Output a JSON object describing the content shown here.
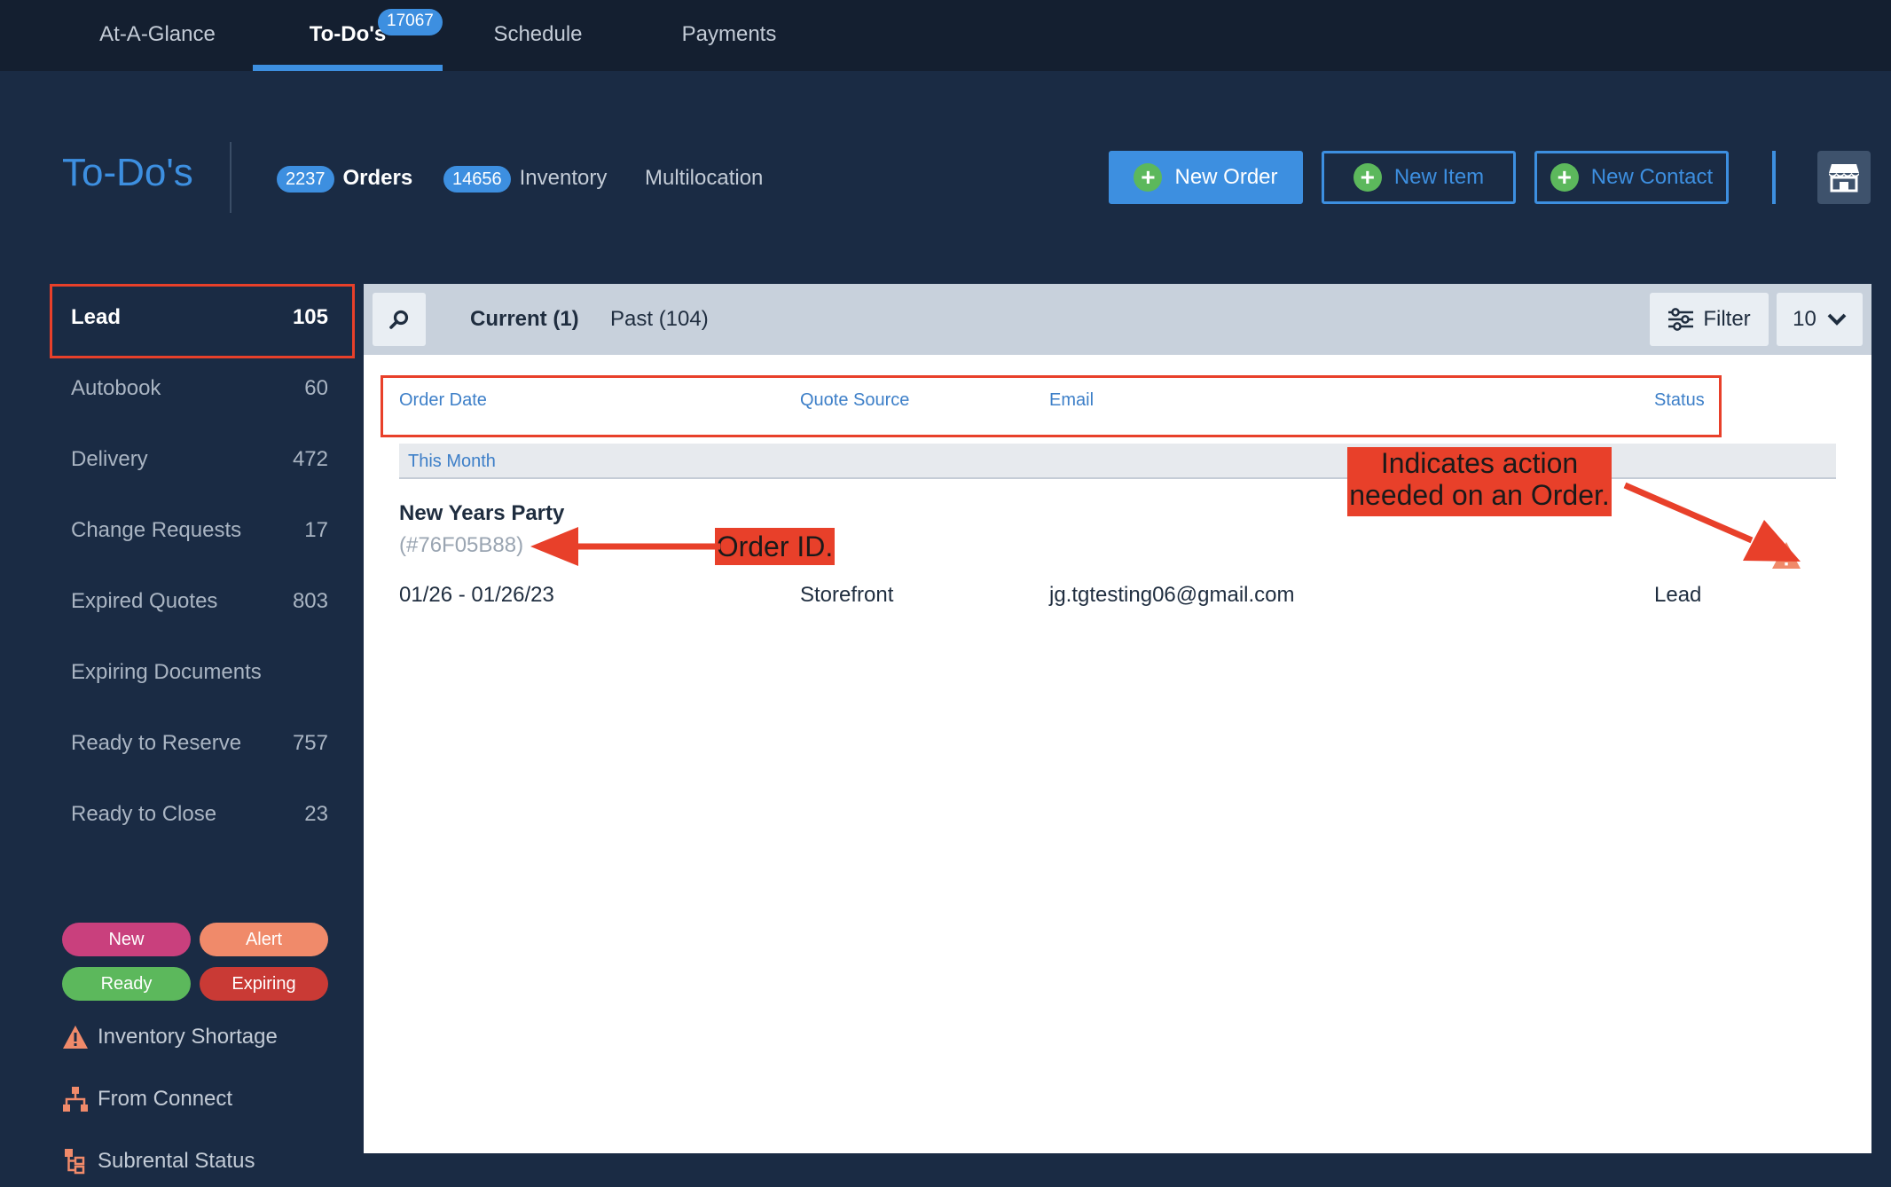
{
  "topnav": {
    "tabs": [
      {
        "label": "At-A-Glance"
      },
      {
        "label": "To-Do's",
        "badge": "17067"
      },
      {
        "label": "Schedule"
      },
      {
        "label": "Payments"
      }
    ]
  },
  "header": {
    "title": "To-Do's",
    "subnav": [
      {
        "badge": "2237",
        "label": "Orders"
      },
      {
        "badge": "14656",
        "label": "Inventory"
      },
      {
        "label": "Multilocation"
      }
    ],
    "buttons": {
      "new_order": "New Order",
      "new_item": "New Item",
      "new_contact": "New Contact"
    }
  },
  "sidebar": {
    "items": [
      {
        "label": "Lead",
        "count": "105"
      },
      {
        "label": "Autobook",
        "count": "60"
      },
      {
        "label": "Delivery",
        "count": "472"
      },
      {
        "label": "Change Requests",
        "count": "17"
      },
      {
        "label": "Expired Quotes",
        "count": "803"
      },
      {
        "label": "Expiring Documents",
        "count": ""
      },
      {
        "label": "Ready to Reserve",
        "count": "757"
      },
      {
        "label": "Ready to Close",
        "count": "23"
      }
    ],
    "pills": [
      {
        "label": "New",
        "color": "#c9407d"
      },
      {
        "label": "Alert",
        "color": "#f08a6a"
      },
      {
        "label": "Ready",
        "color": "#5cb85c"
      },
      {
        "label": "Expiring",
        "color": "#c93a35"
      }
    ],
    "legend": [
      {
        "label": "Inventory Shortage",
        "icon": "warning-icon"
      },
      {
        "label": "From Connect",
        "icon": "network-icon"
      },
      {
        "label": "Subrental Status",
        "icon": "subrental-icon"
      }
    ]
  },
  "toolbar": {
    "tabs": [
      {
        "label": "Current (1)"
      },
      {
        "label": "Past (104)"
      }
    ],
    "filter_label": "Filter",
    "per_page": "10"
  },
  "table": {
    "columns": [
      "Order Date",
      "Quote Source",
      "Email",
      "Status"
    ],
    "group_label": "This Month",
    "rows": [
      {
        "name": "New Years Party",
        "order_id": "(#76F05B88)",
        "date": "01/26 - 01/26/23",
        "source": "Storefront",
        "email": "jg.tgtesting06@gmail.com",
        "status": "Lead"
      }
    ]
  },
  "annotations": {
    "order_id": "Order ID.",
    "action_line1": "Indicates action",
    "action_line2": "needed on an Order."
  },
  "colors": {
    "accent": "#3d8fe0",
    "annotation": "#e8402a",
    "background": "#1a2b44"
  }
}
